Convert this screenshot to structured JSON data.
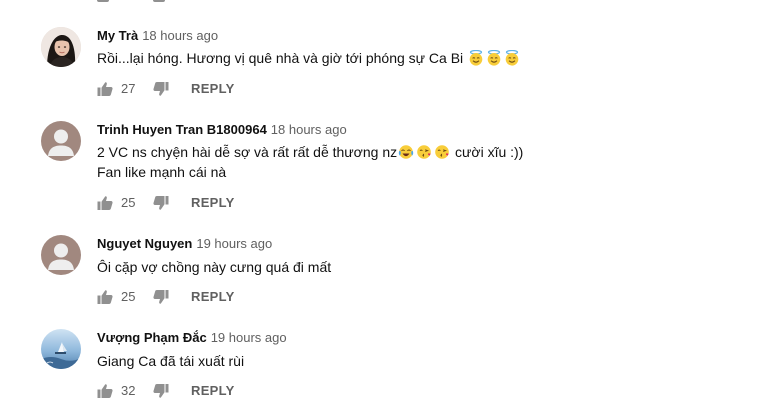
{
  "comments": [
    {
      "author": "My Trà",
      "time": "18 hours ago",
      "lines": [
        "Rồi...lại hóng.  Hương vị quê nhà và giờ tới phóng sự Ca Bi"
      ],
      "emojis_line0": [
        "smiling-face-with-halo",
        "smiling-face-with-halo",
        "smiling-face-with-halo"
      ],
      "likes": "27",
      "reply": "REPLY"
    },
    {
      "author": "Trinh Huyen Tran B1800964",
      "time": "18 hours ago",
      "lines": [
        "2 VC ns chyện hài dễ sợ và rất rất dễ thương nz",
        "cười xĩu :))",
        "Fan like mạnh cái nà"
      ],
      "emojis_line0": [
        "face-with-tears-of-joy",
        "face-blowing-a-kiss",
        "face-blowing-a-kiss"
      ],
      "likes": "25",
      "reply": "REPLY"
    },
    {
      "author": "Nguyet Nguyen",
      "time": "19 hours ago",
      "lines": [
        "Ôi cặp vợ chồng này cưng quá đi mất"
      ],
      "likes": "25",
      "reply": "REPLY"
    },
    {
      "author": "Vượng Phạm Đắc",
      "time": "19 hours ago",
      "lines": [
        "Giang Ca đã tái xuất rùi"
      ],
      "likes": "32",
      "reply": "REPLY"
    }
  ],
  "icons": {
    "like": "thumbs-up-icon",
    "dislike": "thumbs-down-icon",
    "default_avatar": "default-avatar-icon"
  },
  "colors": {
    "meta_gray": "#606060",
    "icon_gray": "#909090",
    "text": "#111111"
  }
}
